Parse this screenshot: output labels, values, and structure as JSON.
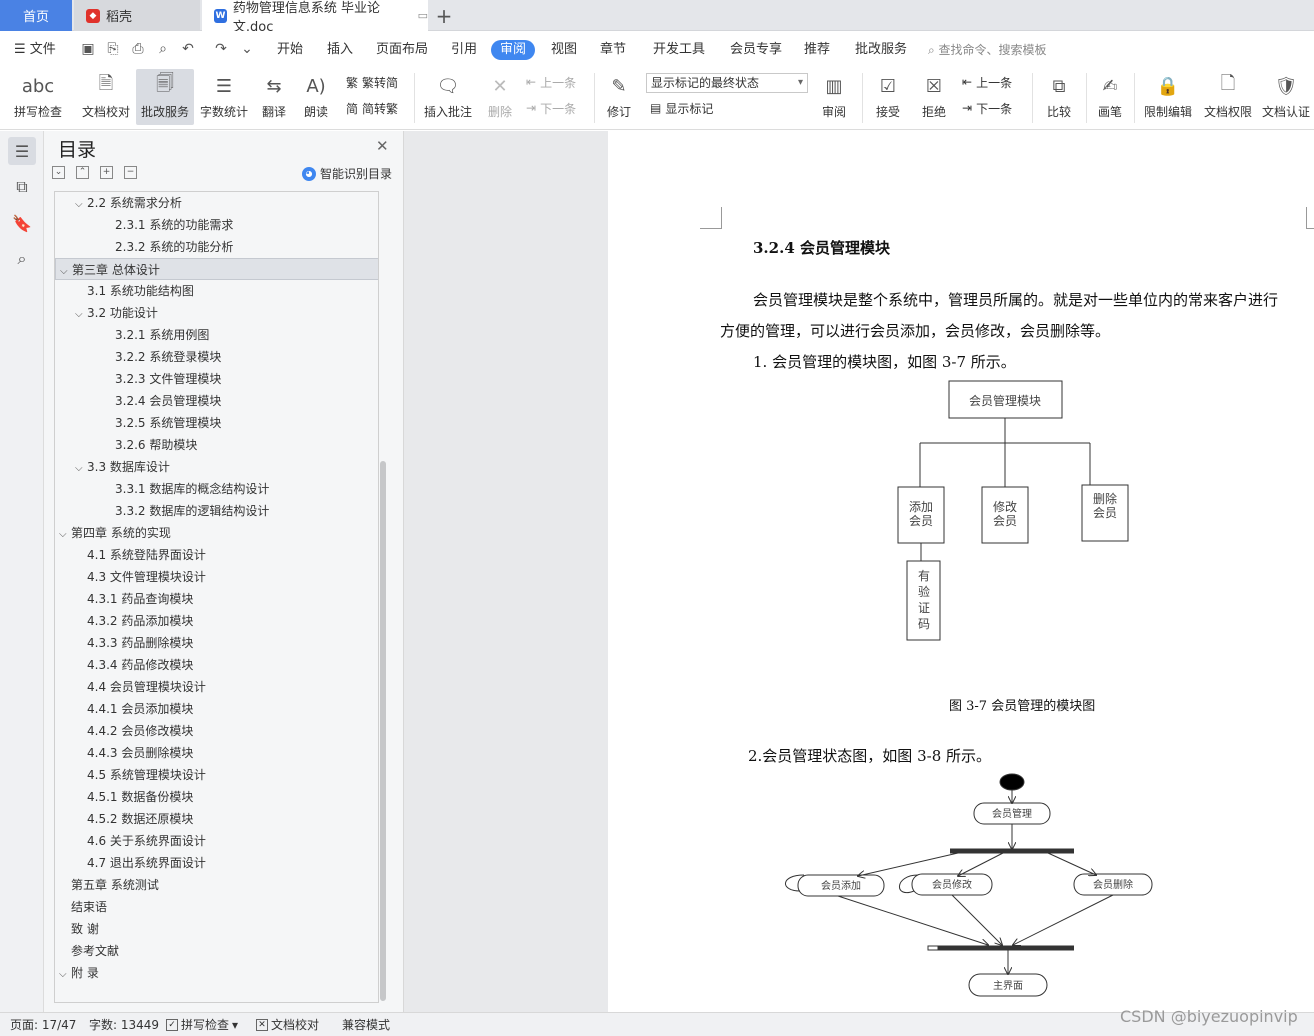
{
  "tabs": {
    "home": "首页",
    "daoke": "稻壳",
    "doc": "药物管理信息系统 毕业论文.doc"
  },
  "menubar": {
    "file": "文件",
    "items": [
      "开始",
      "插入",
      "页面布局",
      "引用",
      "审阅",
      "视图",
      "章节",
      "开发工具",
      "会员专享",
      "推荐",
      "批改服务"
    ],
    "active_index": 4,
    "search_placeholder": "查找命令、搜索模板"
  },
  "ribbon": {
    "spell_check": "拼写检查",
    "doc_proofread": "文档校对",
    "correction_service": "批改服务",
    "word_count": "字数统计",
    "translate": "翻译",
    "read_aloud": "朗读",
    "to_traditional": "繁转简",
    "to_simplified": "简转繁",
    "insert_comment": "插入批注",
    "delete": "删除",
    "prev_comment": "上一条",
    "next_comment": "下一条",
    "revise": "修订",
    "markup_state": "显示标记的最终状态",
    "show_markup": "显示标记",
    "review": "审阅",
    "accept": "接受",
    "reject": "拒绝",
    "prev_change": "上一条",
    "next_change": "下一条",
    "compare": "比较",
    "pen": "画笔",
    "restrict_edit": "限制编辑",
    "doc_permission": "文档权限",
    "doc_certify": "文档认证"
  },
  "toc": {
    "title": "目录",
    "smart_label": "智能识别目录",
    "items": [
      {
        "text": "2.2  系统需求分析",
        "level": 1,
        "caret": "⌵"
      },
      {
        "text": "2.3.1  系统的功能需求",
        "level": 2,
        "caret": ""
      },
      {
        "text": "2.3.2  系统的功能分析",
        "level": 2,
        "caret": ""
      },
      {
        "text": "第三章  总体设计",
        "level": 0,
        "caret": "⌵",
        "selected": true
      },
      {
        "text": "3.1  系统功能结构图",
        "level": 1,
        "caret": ""
      },
      {
        "text": "3.2  功能设计",
        "level": 1,
        "caret": "⌵"
      },
      {
        "text": "3.2.1  系统用例图",
        "level": 2,
        "caret": ""
      },
      {
        "text": "3.2.2  系统登录模块",
        "level": 2,
        "caret": ""
      },
      {
        "text": "3.2.3  文件管理模块",
        "level": 2,
        "caret": ""
      },
      {
        "text": "3.2.4  会员管理模块",
        "level": 2,
        "caret": ""
      },
      {
        "text": "3.2.5  系统管理模块",
        "level": 2,
        "caret": ""
      },
      {
        "text": "3.2.6  帮助模块",
        "level": 2,
        "caret": ""
      },
      {
        "text": "3.3  数据库设计",
        "level": 1,
        "caret": "⌵"
      },
      {
        "text": "3.3.1  数据库的概念结构设计",
        "level": 2,
        "caret": ""
      },
      {
        "text": "3.3.2  数据库的逻辑结构设计",
        "level": 2,
        "caret": ""
      },
      {
        "text": "第四章  系统的实现",
        "level": 0,
        "caret": "⌵"
      },
      {
        "text": "4.1  系统登陆界面设计",
        "level": 1,
        "caret": ""
      },
      {
        "text": "4.3  文件管理模块设计",
        "level": 1,
        "caret": ""
      },
      {
        "text": "4.3.1 药品查询模块",
        "level": 1,
        "caret": ""
      },
      {
        "text": "4.3.2  药品添加模块",
        "level": 1,
        "caret": ""
      },
      {
        "text": "4.3.3 药品删除模块",
        "level": 1,
        "caret": ""
      },
      {
        "text": "4.3.4 药品修改模块",
        "level": 1,
        "caret": ""
      },
      {
        "text": "4.4 会员管理模块设计",
        "level": 1,
        "caret": ""
      },
      {
        "text": "4.4.1 会员添加模块",
        "level": 1,
        "caret": ""
      },
      {
        "text": "4.4.2 会员修改模块",
        "level": 1,
        "caret": ""
      },
      {
        "text": "4.4.3 会员删除模块",
        "level": 1,
        "caret": ""
      },
      {
        "text": "4.5  系统管理模块设计",
        "level": 1,
        "caret": ""
      },
      {
        "text": "4.5.1  数据备份模块",
        "level": 1,
        "caret": ""
      },
      {
        "text": "4.5.2  数据还原模块",
        "level": 1,
        "caret": ""
      },
      {
        "text": "4.6  关于系统界面设计",
        "level": 1,
        "caret": ""
      },
      {
        "text": "4.7  退出系统界面设计",
        "level": 1,
        "caret": ""
      },
      {
        "text": "第五章  系统测试",
        "level": 0,
        "caret": ""
      },
      {
        "text": "结束语",
        "level": 0,
        "caret": ""
      },
      {
        "text": "致    谢",
        "level": 0,
        "caret": ""
      },
      {
        "text": "参考文献",
        "level": 0,
        "caret": ""
      },
      {
        "text": "附    录",
        "level": 0,
        "caret": "⌵"
      }
    ]
  },
  "doc": {
    "heading": "3.2.4 会员管理模块",
    "para_line1": "会员管理模块是整个系统中，管理员所属的。就是对一些单位内的常来客户进行",
    "para_line2": "方便的管理，可以进行会员添加，会员修改，会员删除等。",
    "item1": "1.  会员管理的模块图，如图 3-7 所示。",
    "module_root": "会员管理模块",
    "module_add_1": "添加",
    "module_add_2": "会员",
    "module_edit_1": "修改",
    "module_edit_2": "会员",
    "module_del_1": "删除",
    "module_del_2": "会员",
    "module_verify": [
      "有",
      "验",
      "证",
      "码"
    ],
    "fig_caption": "图 3-7  会员管理的模块图",
    "item2": "2.会员管理状态图，如图 3-8 所示。",
    "state_root": "会员管理",
    "state_add": "会员添加",
    "state_edit": "会员修改",
    "state_del": "会员删除",
    "state_main": "主界面"
  },
  "status": {
    "page": "页面: 17/47",
    "words": "字数: 13449",
    "spell": "拼写检查",
    "proof": "文档校对",
    "compat": "兼容模式"
  },
  "watermark": "CSDN @biyezuopinvip"
}
